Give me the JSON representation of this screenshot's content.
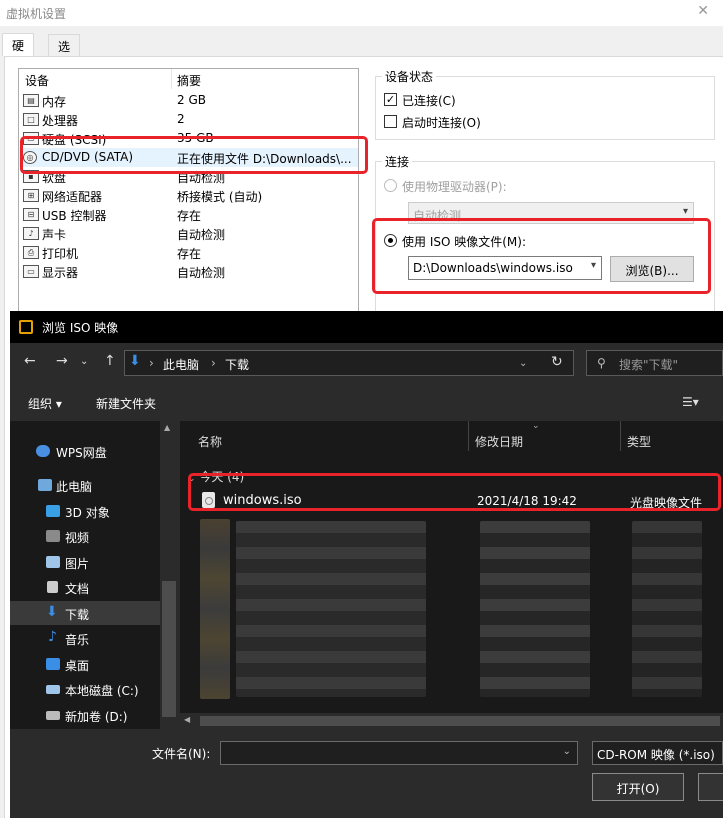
{
  "vm_window": {
    "title": "虚拟机设置",
    "tabs": [
      "硬件",
      "选项"
    ],
    "device_list": {
      "col_device": "设备",
      "col_summary": "摘要",
      "rows": [
        {
          "name": "内存",
          "summary": "2 GB",
          "icon": "memory-icon"
        },
        {
          "name": "处理器",
          "summary": "2",
          "icon": "cpu-icon"
        },
        {
          "name": "硬盘 (SCSI)",
          "summary": "35 GB",
          "icon": "hard-disk-icon"
        },
        {
          "name": "CD/DVD (SATA)",
          "summary": "正在使用文件 D:\\Downloads\\...",
          "icon": "cd-dvd-icon"
        },
        {
          "name": "软盘",
          "summary": "自动检测",
          "icon": "floppy-icon"
        },
        {
          "name": "网络适配器",
          "summary": "桥接模式 (自动)",
          "icon": "network-adapter-icon"
        },
        {
          "name": "USB 控制器",
          "summary": "存在",
          "icon": "usb-icon"
        },
        {
          "name": "声卡",
          "summary": "自动检测",
          "icon": "sound-card-icon"
        },
        {
          "name": "打印机",
          "summary": "存在",
          "icon": "printer-icon"
        },
        {
          "name": "显示器",
          "summary": "自动检测",
          "icon": "monitor-icon"
        }
      ]
    },
    "device_status": {
      "title": "设备状态",
      "connected": "已连接(C)",
      "connect_at_power_on": "启动时连接(O)"
    },
    "connection": {
      "title": "连接",
      "physical_drive": "使用物理驱动器(P):",
      "physical_drive_value": "自动检测",
      "iso_option": "使用 ISO 映像文件(M):",
      "iso_path": "D:\\Downloads\\windows.iso",
      "browse_button": "浏览(B)..."
    }
  },
  "file_dialog": {
    "title": "浏览 ISO 映像",
    "breadcrumb": [
      "此电脑",
      "下载"
    ],
    "search_placeholder": "搜索\"下载\"",
    "toolbar": {
      "organize": "组织 ▾",
      "new_folder": "新建文件夹"
    },
    "nav_items": [
      {
        "label": "WPS网盘",
        "icon": "cloud-icon",
        "color": "#4a90e2"
      },
      {
        "label": "此电脑",
        "icon": "this-pc-icon",
        "color": "#6fa8dc"
      },
      {
        "label": "3D 对象",
        "icon": "3d-objects-icon",
        "color": "#3aa0e6"
      },
      {
        "label": "视频",
        "icon": "video-icon",
        "color": "#8a8a8a"
      },
      {
        "label": "图片",
        "icon": "pictures-icon",
        "color": "#9fc5e8"
      },
      {
        "label": "文档",
        "icon": "documents-icon",
        "color": "#cccccc"
      },
      {
        "label": "下载",
        "icon": "downloads-icon",
        "color": "#3a8ee6"
      },
      {
        "label": "音乐",
        "icon": "music-icon",
        "color": "#3a8ee6"
      },
      {
        "label": "桌面",
        "icon": "desktop-icon",
        "color": "#3a8ee6"
      },
      {
        "label": "本地磁盘 (C:)",
        "icon": "local-disk-icon",
        "color": "#9fc5e8"
      },
      {
        "label": "新加卷 (D:)",
        "icon": "drive-icon",
        "color": "#bbbbbb"
      }
    ],
    "columns": {
      "name": "名称",
      "date": "修改日期",
      "type": "类型"
    },
    "group_header": "今天 (4)",
    "file": {
      "name": "windows.iso",
      "date": "2021/4/18 19:42",
      "type": "光盘映像文件"
    },
    "filename_label": "文件名(N):",
    "filename_value": "",
    "filter": "CD-ROM 映像 (*.iso)",
    "open_button": "打开(O)"
  },
  "colors": {
    "highlight_red": "#e8242a",
    "dialog_bg": "#2b2b2b",
    "selection": "#e5f3ff"
  }
}
